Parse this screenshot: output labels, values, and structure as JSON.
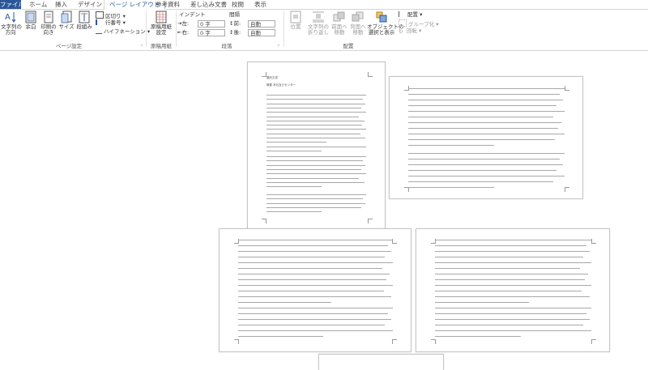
{
  "tabs": {
    "file": "ファイル",
    "home": "ホーム",
    "insert": "挿入",
    "design": "デザイン",
    "page_layout": "ページ レイアウト",
    "references": "参考資料",
    "mailings": "差し込み文書",
    "review": "校閲",
    "view": "表示"
  },
  "ribbon": {
    "page_setup": {
      "text_direction": "文字列の\n方向",
      "margins": "余白",
      "orientation": "印刷の\n向き",
      "size": "サイズ",
      "columns": "段組み",
      "breaks": "区切り",
      "line_numbers": "行番号",
      "hyphenation": "ハイフネーション",
      "group_label": "ページ設定"
    },
    "manuscript": {
      "settings": "原稿用紙\n設定",
      "group_label": "原稿用紙"
    },
    "paragraph": {
      "indent_label": "インデント",
      "spacing_label": "間隔",
      "left_label": "左:",
      "left_value": "0 字",
      "right_label": "右:",
      "right_value": "0 字",
      "before_label": "前:",
      "before_value": "自動",
      "after_label": "後:",
      "after_value": "自動",
      "group_label": "段落"
    },
    "arrange": {
      "position": "位置",
      "wrap_text": "文字列の\n折り返し",
      "bring_forward": "前面へ\n移動",
      "send_backward": "背面へ\n移動",
      "selection_pane": "オブジェクトの\n選択と表示",
      "align": "配置",
      "group": "グループ化",
      "rotate": "回転",
      "group_label": "配置"
    }
  },
  "document": {
    "page1_heading1": "要約文書",
    "page1_heading2": "概要 本社及びセンター"
  },
  "colors": {
    "accent": "#2b579a",
    "disabled": "#9a9a9a"
  }
}
